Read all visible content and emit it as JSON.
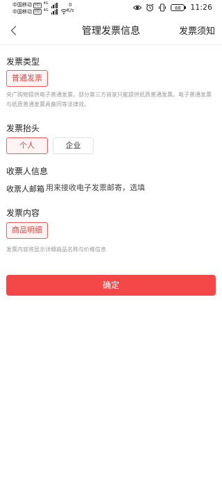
{
  "status_bar": {
    "carrier1": "中国移动",
    "carrier2": "中国移动",
    "hd": "HD",
    "net1": "4G",
    "net2": "4G",
    "speed_value": "0",
    "speed_unit": "K/s",
    "battery": "88",
    "time": "11:26"
  },
  "nav": {
    "title": "管理发票信息",
    "right_link": "发票须知"
  },
  "invoice_type": {
    "title": "发票类型",
    "option": "普通发票",
    "note": "央广购物提供电子普通发票，部分第三方商家只能提供纸质普通发票。电子普通发票与纸质普通发票具备同等法律效。"
  },
  "invoice_header": {
    "title": "发票抬头",
    "options": [
      "个人",
      "企业"
    ],
    "selected": "个人"
  },
  "recipient": {
    "title": "收票人信息",
    "email_label": "收票人邮箱",
    "email_placeholder": "用来接收电子发票邮寄，选填",
    "email_value": ""
  },
  "invoice_content": {
    "title": "发票内容",
    "option": "商品明细",
    "note": "发票内容将显示详细商品名称与价格信息"
  },
  "actions": {
    "confirm": "确定"
  },
  "colors": {
    "accent": "#f44848",
    "chip_active_border": "#f05b57",
    "chip_active_bg": "#fff3f3"
  },
  "icons": {
    "back": "chevron-left-icon",
    "eye": "eye-icon",
    "alarm": "alarm-icon",
    "vibrate": "vibrate-icon"
  }
}
